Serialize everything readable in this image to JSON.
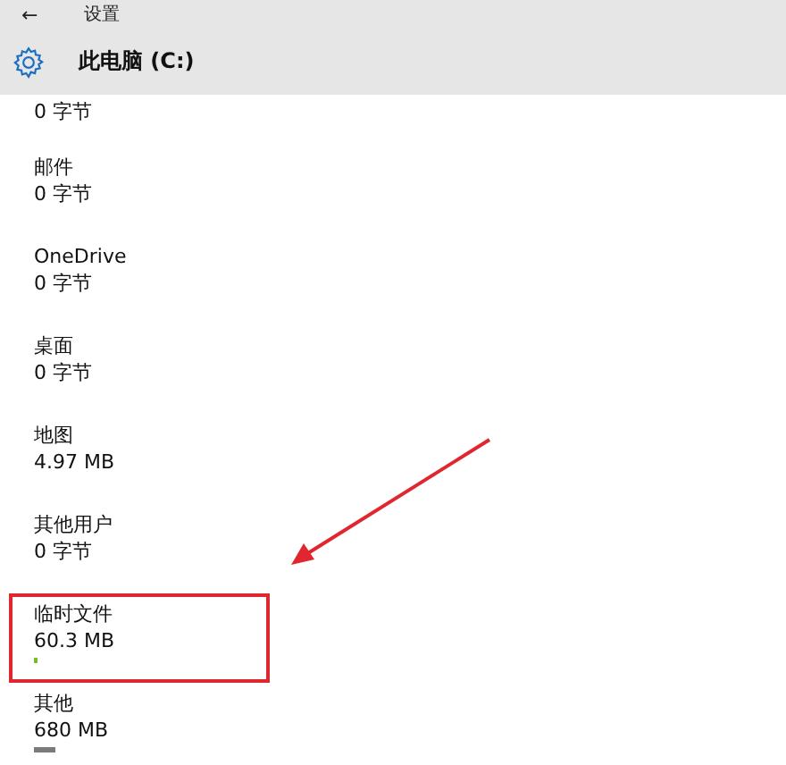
{
  "window": {
    "title": "设置",
    "back": "←"
  },
  "header": {
    "title": "此电脑 (C:)"
  },
  "items": [
    {
      "size": "0 字节",
      "highlighted": false
    },
    {
      "name": "邮件",
      "size": "0 字节",
      "highlighted": false
    },
    {
      "name": "OneDrive",
      "size": "0 字节",
      "highlighted": false
    },
    {
      "name": "桌面",
      "size": "0 字节",
      "highlighted": false
    },
    {
      "name": "地图",
      "size": "4.97 MB",
      "highlighted": false
    },
    {
      "name": "其他用户",
      "size": "0 字节",
      "highlighted": false
    },
    {
      "name": "临时文件",
      "size": "60.3 MB",
      "color": "#7dbb2a",
      "highlighted": true
    },
    {
      "name": "其他",
      "size": "680 MB",
      "level": 0.1,
      "color": "#7a7a7a",
      "highlighted": false
    }
  ]
}
